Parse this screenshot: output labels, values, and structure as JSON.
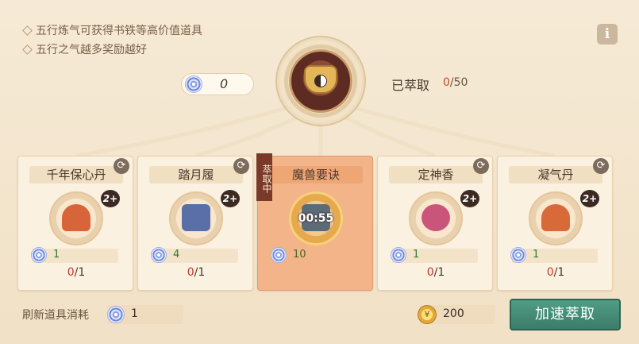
{
  "tips": [
    "五行炼气可获得书铁等高价值道具",
    "五行之气越多奖励越好"
  ],
  "info_button": "i",
  "qi_counter": "0",
  "extracted": {
    "label": "已萃取",
    "current": "0",
    "total": "/50"
  },
  "cards": [
    {
      "name": "千年保心丹",
      "badge": "2+",
      "cost": "1",
      "progress_cur": "0",
      "progress_total": "/1",
      "active": false,
      "art_color": "#d8653a"
    },
    {
      "name": "踏月履",
      "badge": "2+",
      "cost": "4",
      "progress_cur": "0",
      "progress_total": "/1",
      "active": false,
      "art_color": "#5a6fa8"
    },
    {
      "name": "魔兽要诀",
      "timer": "00:55",
      "cost": "10",
      "tag": "萃取中",
      "active": true,
      "art_color": "#5b6b78"
    },
    {
      "name": "定神香",
      "badge": "2+",
      "cost": "1",
      "progress_cur": "0",
      "progress_total": "/1",
      "active": false,
      "art_color": "#c9567a"
    },
    {
      "name": "凝气丹",
      "badge": "2+",
      "cost": "1",
      "progress_cur": "0",
      "progress_total": "/1",
      "active": false,
      "art_color": "#d86a3a"
    }
  ],
  "refresh_label": "刷新道具消耗",
  "refresh_cost": "1",
  "gold": "200",
  "speed_button": "加速萃取",
  "icons": {
    "refresh": "refresh-icon",
    "qi": "spiral-qi-icon",
    "coin": "coin-icon"
  }
}
